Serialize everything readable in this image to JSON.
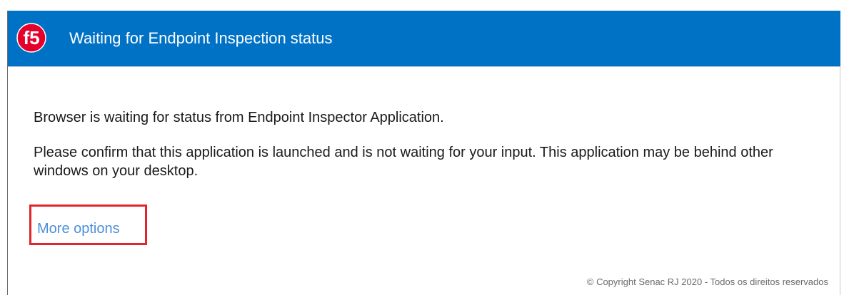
{
  "header": {
    "logo_icon": "f5-logo-icon",
    "logo_text": "f5",
    "title": "Waiting for Endpoint Inspection status",
    "background_color": "#0072c6"
  },
  "content": {
    "message_1": "Browser is waiting for status from Endpoint Inspector Application.",
    "message_2": "Please confirm that this application is launched and is not waiting for your input. This application may be behind other windows on your desktop."
  },
  "more_options": {
    "label": "More options",
    "link_color": "#4d8fd9",
    "highlight_color": "#e3242b"
  },
  "footer": {
    "copyright": "© Copyright Senac RJ 2020 - Todos os direitos reservados"
  }
}
